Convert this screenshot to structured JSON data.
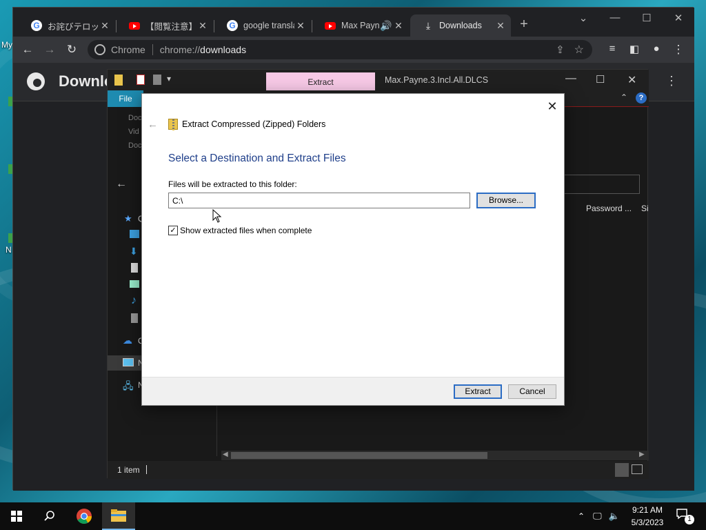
{
  "desktop": {
    "icon_labels": [
      "My",
      "N"
    ]
  },
  "browser": {
    "tabs": [
      {
        "title": "お詫びテロップ",
        "favicon": "google-g-icon"
      },
      {
        "title": "【閲覧注意】放",
        "favicon": "youtube-icon"
      },
      {
        "title": "google transla",
        "favicon": "google-g-icon"
      },
      {
        "title": "Max Payne",
        "favicon": "youtube-icon"
      },
      {
        "title": "Downloads",
        "favicon": "download-icon"
      }
    ],
    "new_tab_glyph": "+",
    "address_scheme": "Chrome",
    "address_prefix": "chrome://",
    "address_host": "downloads",
    "page_title": "Downlo"
  },
  "explorer": {
    "context_tab": "Extract",
    "window_title": "Max.Payne.3.Incl.All.DLCS",
    "file_tab": "File",
    "column_password": "Password ...",
    "column_size": "Si",
    "status": "1 item",
    "recent_items": [
      "Doc",
      "Vid",
      "Doc"
    ],
    "nav_labels": [
      "Q",
      "O",
      "N",
      "N"
    ]
  },
  "dialog": {
    "caption": "Extract Compressed (Zipped) Folders",
    "heading": "Select a Destination and Extract Files",
    "folder_label": "Files will be extracted to this folder:",
    "folder_value": "C:\\",
    "browse_label": "Browse...",
    "checkbox_label": "Show extracted files when complete",
    "checkbox_checked": true,
    "extract_label": "Extract",
    "cancel_label": "Cancel"
  },
  "taskbar": {
    "time": "9:21 AM",
    "date": "5/3/2023",
    "notification_count": "1"
  },
  "colors": {
    "accent": "#2b6cc4",
    "heading": "#1f3f8a",
    "context_tab": "#f7c9e6"
  }
}
